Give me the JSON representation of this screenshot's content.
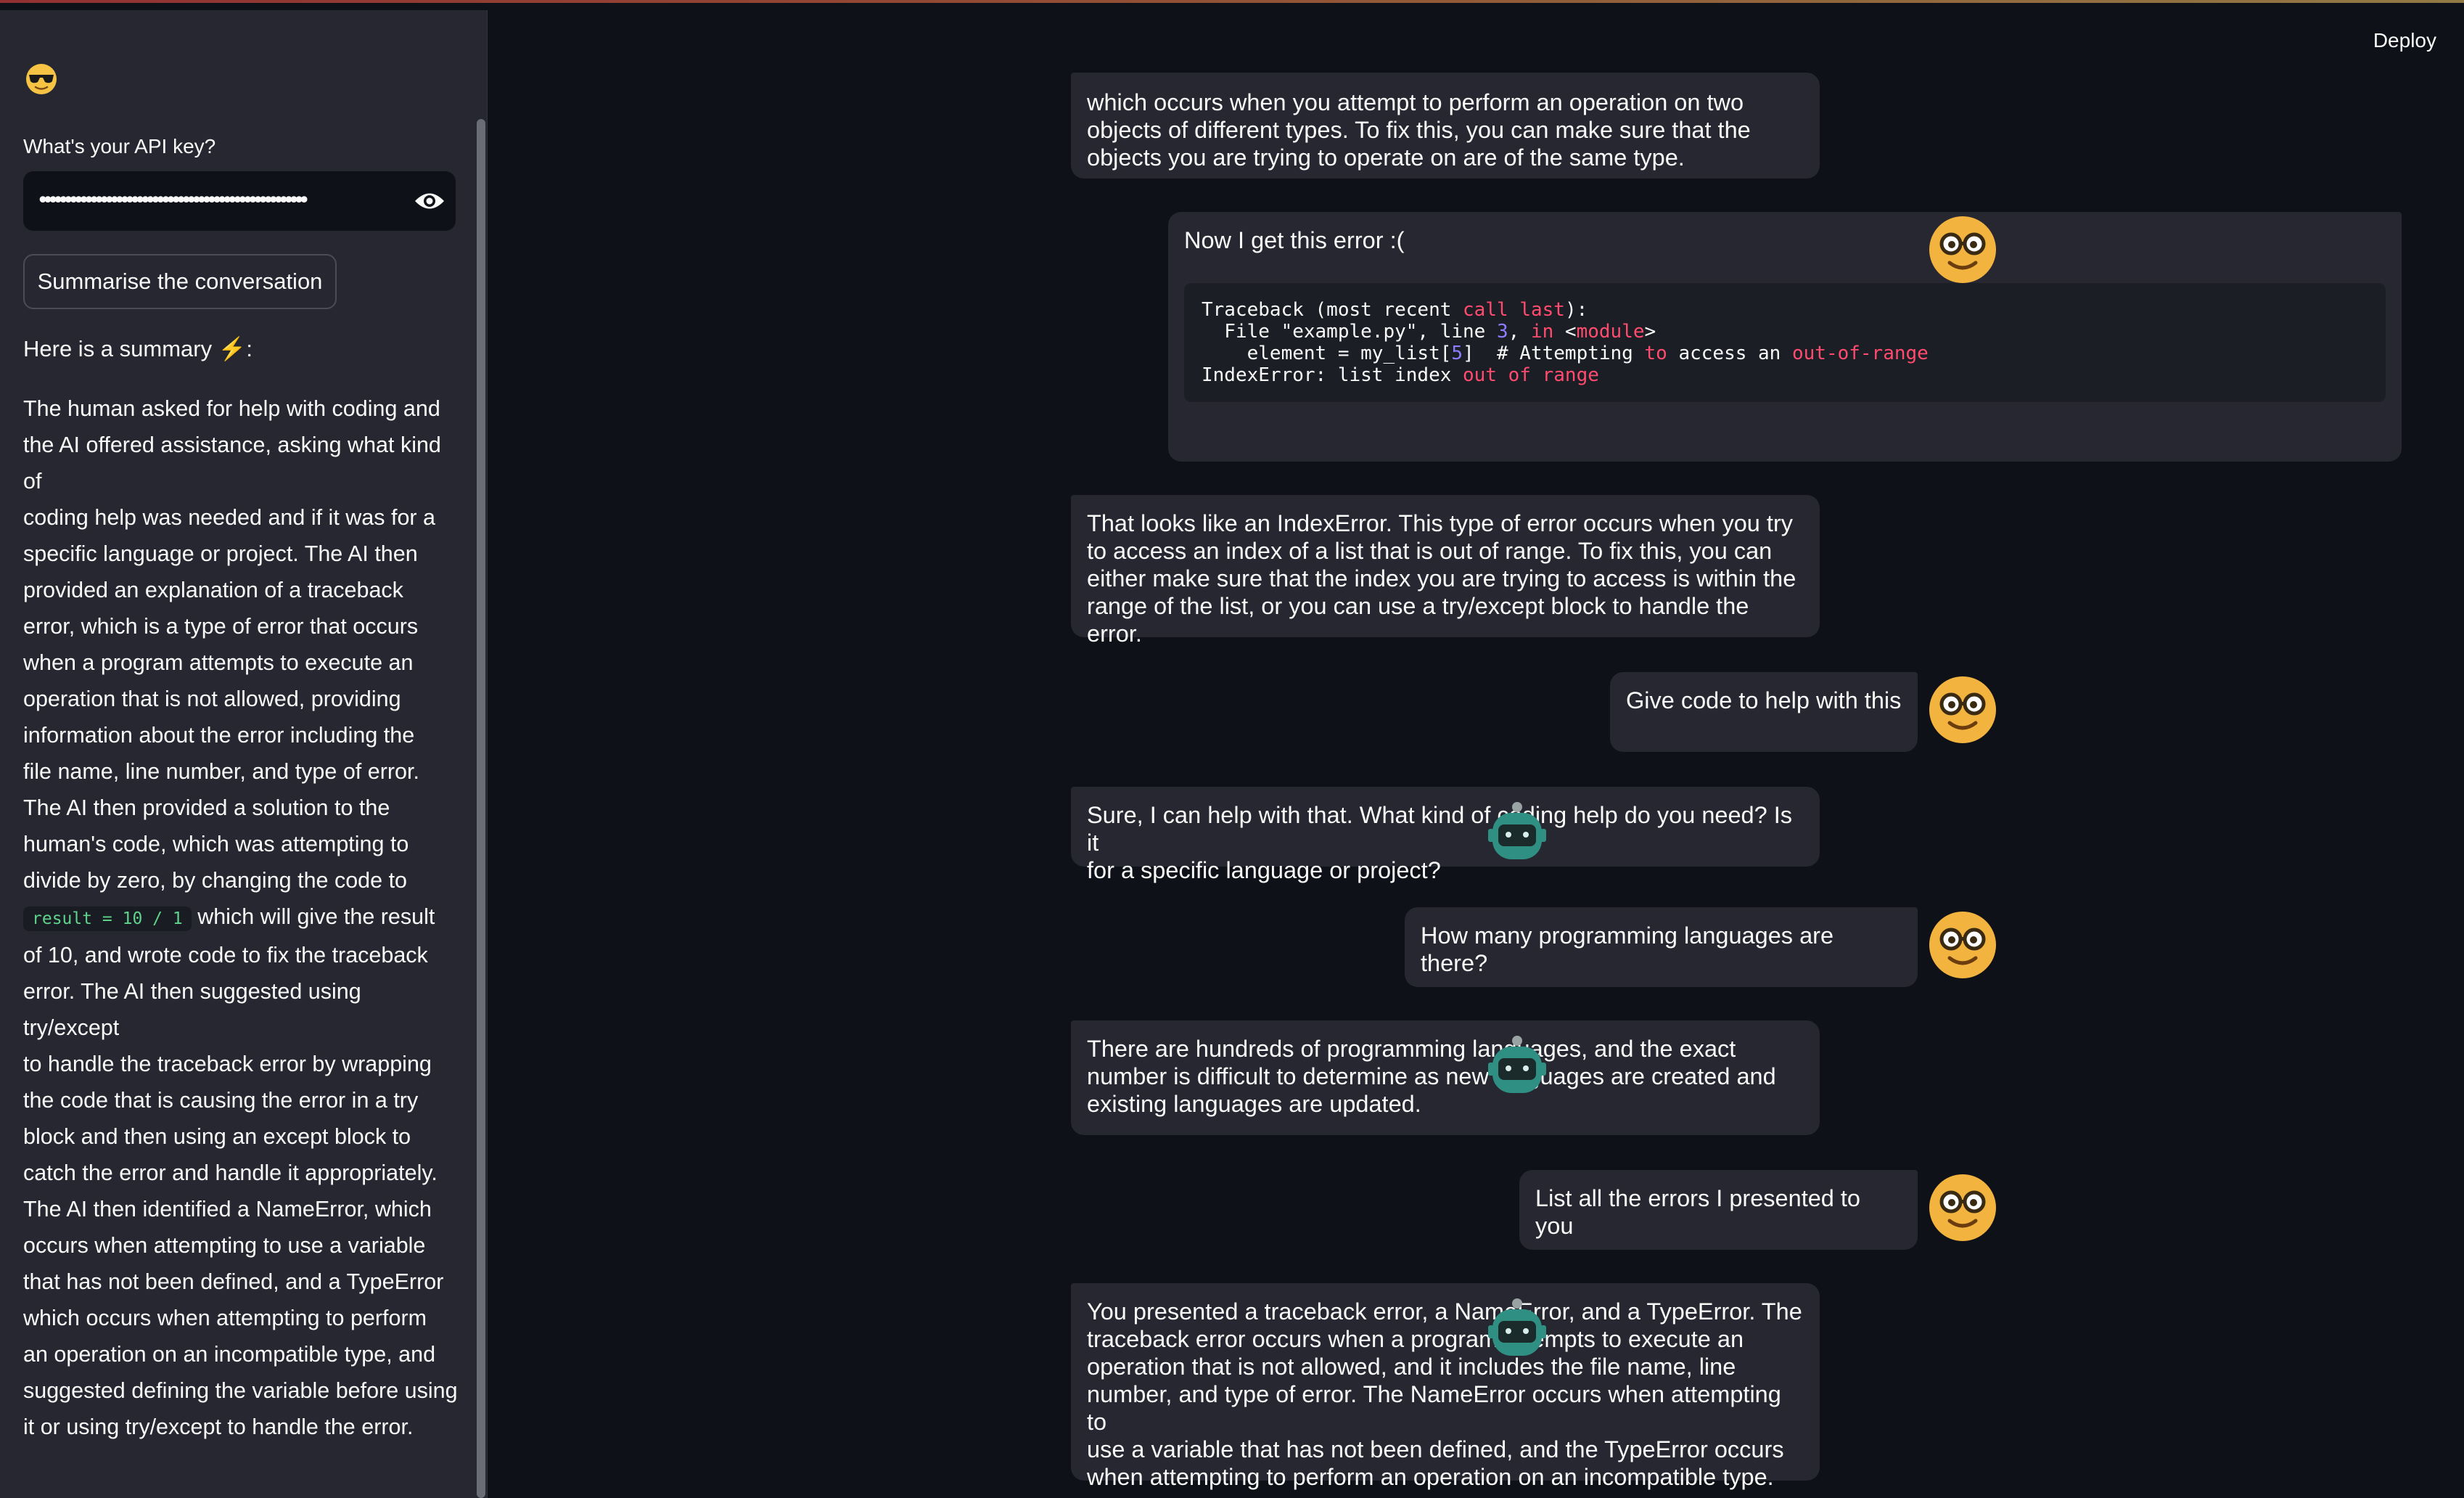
{
  "app": {
    "deploy_label": "Deploy"
  },
  "sidebar": {
    "api_label": "What's your API key?",
    "api_value": "••••••••••••••••••••••••••••••••••••••••••••••••••••",
    "summarise_button": "Summarise the conversation",
    "summary_heading": "Here is a summary ⚡:",
    "summary_lines": [
      "The human asked for help with coding and",
      "the AI offered assistance, asking what kind of",
      "coding help was needed and if it was for a",
      "specific language or project. The AI then",
      "provided an explanation of a traceback",
      "error, which is a type of error that occurs",
      "when a program attempts to execute an",
      "operation that is not allowed, providing",
      "information about the error including the",
      "file name, line number, and type of error.",
      "The AI then provided a solution to the",
      "human's code, which was attempting to",
      "divide by zero, by changing the code to"
    ],
    "summary_code": "result = 10 / 1",
    "summary_after_code": " which will give the result",
    "summary_lines_2": [
      "of 10, and wrote code to fix the traceback",
      "error. The AI then suggested using try/except",
      "to handle the traceback error by wrapping",
      "the code that is causing the error in a try",
      "block and then using an except block to",
      "catch the error and handle it appropriately.",
      "The AI then identified a NameError, which",
      "occurs when attempting to use a variable",
      "that has not been defined, and a TypeError",
      "which occurs when attempting to perform",
      "an operation on an incompatible type, and",
      "suggested defining the variable before using",
      "it or using try/except to handle the error."
    ]
  },
  "chat": {
    "msg0_ai_tail": [
      "which occurs when you attempt to perform an operation on two",
      "objects of different types. To fix this, you can make sure that the",
      "objects you are trying to operate on are of the same type."
    ],
    "msg1_user": "Now I get this error :(",
    "msg1_code": {
      "line1_a": "Traceback (most recent ",
      "line1_kw1": "call",
      "line1_sp": " ",
      "line1_kw2": "last",
      "line1_b": "):",
      "line2_a": "  File \"example.py\", line ",
      "line2_num": "3",
      "line2_b": ", ",
      "line2_kw": "in",
      "line2_c": " <",
      "line2_kw2": "module",
      "line2_d": ">",
      "line3_a": "    element = my_list[",
      "line3_num": "5",
      "line3_b": "]  # Attempting ",
      "line3_kw": "to",
      "line3_c": " access an ",
      "line3_kw2": "out-of-range",
      "line4_a": "IndexError: list index ",
      "line4_kw": "out of range"
    },
    "msg2_ai": [
      "That looks like an IndexError. This type of error occurs when you try",
      "to access an index of a list that is out of range. To fix this, you can",
      "either make sure that the index you are trying to access is within the",
      "range of the list, or you can use a try/except block to handle the error."
    ],
    "msg3_user": "Give code to help with this",
    "msg4_ai": [
      "Sure, I can help with that. What kind of coding help do you need? Is it",
      "for a specific language or project?"
    ],
    "msg5_user": "How many programming languages are there?",
    "msg6_ai": [
      "There are hundreds of programming languages, and the exact",
      "number is difficult to determine as new languages are created and",
      "existing languages are updated."
    ],
    "msg7_user": "List all the errors I presented to you",
    "msg8_ai": [
      "You presented a traceback error, a NameError, and a TypeError. The",
      "traceback error occurs when a program attempts to execute an",
      "operation that is not allowed, and it includes the file name, line",
      "number, and type of error. The NameError occurs when attempting to",
      "use a variable that has not been defined, and the TypeError occurs",
      "when attempting to perform an operation on an incompatible type."
    ]
  }
}
